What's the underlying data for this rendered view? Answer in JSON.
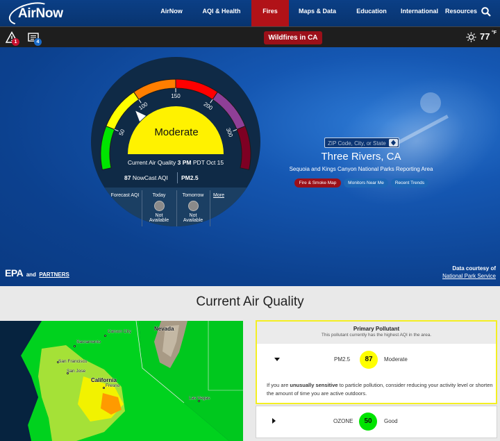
{
  "nav": {
    "logo": "AirNow",
    "items": [
      {
        "label": "AirNow",
        "x": 0
      },
      {
        "label": "AQI & Health"
      },
      {
        "label": "Fires"
      },
      {
        "label": "Maps & Data"
      },
      {
        "label": "Education"
      },
      {
        "label": "International"
      },
      {
        "label": "Resources"
      }
    ],
    "active_item": "Fires",
    "search_icon": "search-icon"
  },
  "alert_bar": {
    "alerts_icon": "warning-icon",
    "alerts_count": "1",
    "news_icon": "news-icon",
    "news_count": "4",
    "wildfire_label": "Wildfires in CA",
    "weather_icon": "sun-icon",
    "temperature": "77",
    "temp_unit": "°F"
  },
  "gauge": {
    "status": "Moderate",
    "status_color": "#fff200",
    "tick_labels": [
      "50",
      "100",
      "150",
      "200",
      "300"
    ],
    "current_label": "Current Air Quality",
    "current_time": "3 PM",
    "current_date": "PDT Oct 15",
    "nowcast_value": "87",
    "nowcast_label": "NowCast AQI",
    "pollutant": "PM2.5",
    "aqi_value": 87,
    "band_colors": [
      "#00e400",
      "#ffff00",
      "#ff7e00",
      "#ff0000",
      "#8f3f97",
      "#7e0023"
    ]
  },
  "forecast": {
    "label": "Forecast AQI",
    "today_label": "Today",
    "today_value_1": "Not",
    "today_value_2": "Available",
    "tomorrow_label": "Tomorrow",
    "tomorrow_value_1": "Not",
    "tomorrow_value_2": "Available",
    "more_link": "More"
  },
  "location": {
    "search_placeholder": "ZIP Code, City, or State",
    "city": "Three Rivers, CA",
    "reporting_area": "Sequoia and Kings Canyon National Parks Reporting Area",
    "buttons": {
      "fire_smoke": "Fire & Smoke Map",
      "monitors": "Monitors Near Me",
      "trends": "Recent Trends"
    }
  },
  "footer_hero": {
    "epa_mark": "EPA",
    "epa_and": "and",
    "partners_link": "PARTNERS",
    "courtesy_line1": "Data courtesy of",
    "courtesy_line2": "National Park Service"
  },
  "section_title": "Current Air Quality",
  "map": {
    "cities": [
      "Carson City",
      "Sacramento",
      "San Francisco",
      "San Jose",
      "California",
      "Fresno",
      "Nevada",
      "Las Vegas"
    ]
  },
  "primary": {
    "title": "Primary Pollutant",
    "subtitle": "This pollutant currently has the highest AQI in the area.",
    "pollutant": "PM2.5",
    "aqi": "87",
    "aqi_color": "#ffff00",
    "category": "Moderate",
    "advice_pre": "If you are ",
    "advice_bold": "unusually sensitive",
    "advice_post": " to particle pollution, consider reducing your activity level or shorten the amount of time you are active outdoors."
  },
  "secondary": {
    "pollutant": "OZONE",
    "aqi": "50",
    "aqi_color": "#00e400",
    "category": "Good"
  }
}
